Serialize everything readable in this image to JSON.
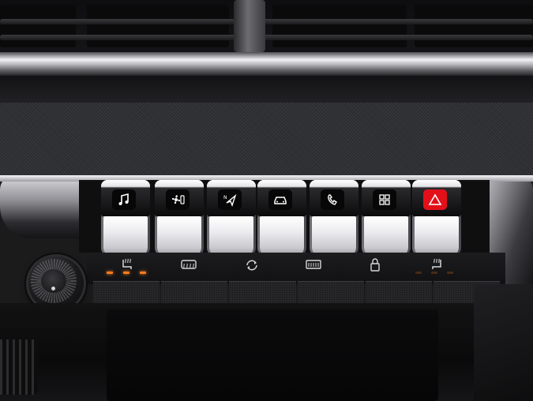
{
  "scene": {
    "colors": {
      "hazard_red": "#e3101a",
      "indicator_orange": "#ff7a1c",
      "chrome": "#e8e8ec"
    }
  },
  "top_switches": [
    {
      "icon": "music-note-icon"
    },
    {
      "icon": "fan-ventilation-icon"
    },
    {
      "icon": "navigation-arrow-icon"
    },
    {
      "icon": "car-front-icon"
    },
    {
      "icon": "phone-handset-icon"
    },
    {
      "icon": "apps-grid-icon"
    },
    {
      "icon": "hazard-triangle-icon"
    }
  ],
  "lower_controls": [
    {
      "icon": "heated-seat-left-icon",
      "indicator_level": 3
    },
    {
      "icon": "rear-defrost-icon"
    },
    {
      "icon": "air-recirculation-icon"
    },
    {
      "icon": "front-defrost-icon"
    },
    {
      "icon": "door-lock-icon"
    },
    {
      "icon": "heated-seat-right-icon"
    }
  ],
  "volume_knob": {
    "icon": "power-volume-knob-icon"
  }
}
